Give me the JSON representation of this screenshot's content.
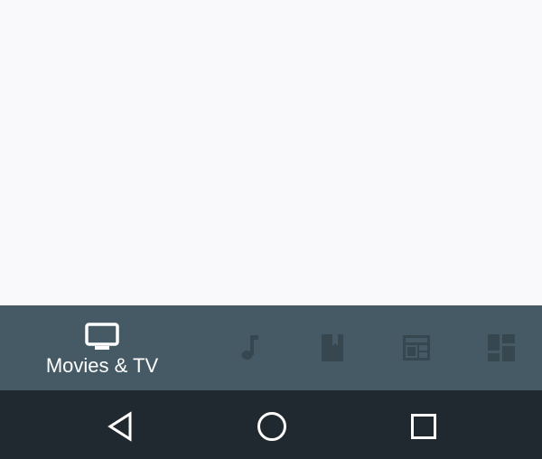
{
  "bottom_nav": {
    "active_tab": {
      "label": "Movies & TV",
      "icon": "tv-icon",
      "color": "#ffffff"
    },
    "inactive_tabs": [
      {
        "icon": "music-note-icon"
      },
      {
        "icon": "book-icon"
      },
      {
        "icon": "newsstand-icon"
      },
      {
        "icon": "dashboard-icon"
      }
    ],
    "inactive_icon_color": "#37474f",
    "background": "#455a64"
  },
  "system_nav": {
    "buttons": [
      {
        "icon": "back-triangle-icon"
      },
      {
        "icon": "home-circle-icon"
      },
      {
        "icon": "recents-square-icon"
      }
    ],
    "background": "#1f292f",
    "icon_color": "#ffffff"
  },
  "content": {
    "background": "#f9f8fa"
  }
}
